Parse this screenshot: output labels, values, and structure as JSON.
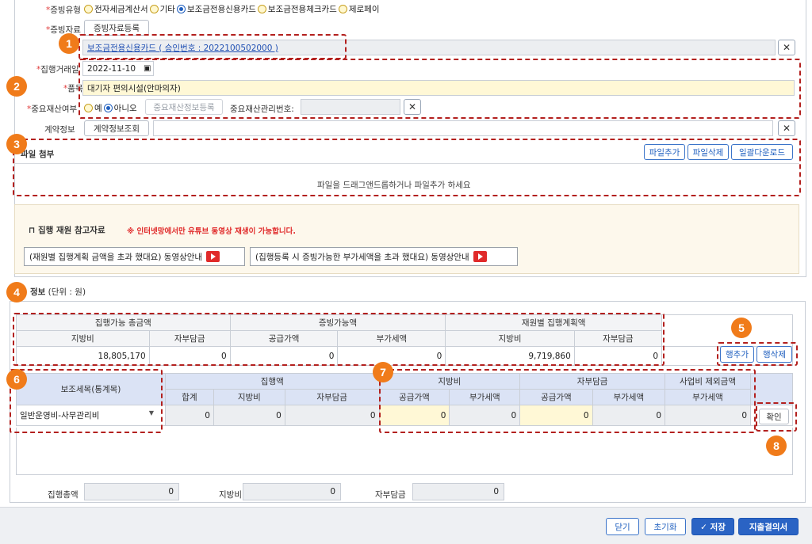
{
  "evidence_type": {
    "label": "증빙유형",
    "options": [
      "전자세금계산서",
      "기타",
      "보조금전용신용카드",
      "보조금전용체크카드",
      "제로페이"
    ],
    "selected": "보조금전용신용카드"
  },
  "evidence_data": {
    "label": "증빙자료",
    "button": "증빙자료등록",
    "link": "보조금전용신용카드 ( 승인번호 : 2022100502000 )"
  },
  "transaction_date": {
    "label": "집행거래일",
    "value": "2022-11-10"
  },
  "item": {
    "label": "품목",
    "value": "대기자 편의시설(안마의자)"
  },
  "important_asset": {
    "label": "중요재산여부",
    "options": [
      "예",
      "아니오"
    ],
    "selected": "아니오",
    "register_button": "중요재산정보등록",
    "mgmt_label": "중요재산관리번호:"
  },
  "contract": {
    "label": "계약정보",
    "button": "계약정보조회"
  },
  "attachment": {
    "title": "파일 첨부",
    "buttons": [
      "파일추가",
      "파일삭제",
      "일괄다운로드"
    ],
    "dropzone": "파일을 드래그앤드롭하거나  파일추가 하세요"
  },
  "reference": {
    "title": "집행 재원 참고자료",
    "notice": "※ 인터넷망에서만 유튜브 동영상 재생이 가능합니다.",
    "video1": "(재원별 집행계획 금액을 초과 했대요) 동영상안내",
    "video2": "(집행등록 시 증빙가능한 부가세액을 초과 했대요) 동영상안내"
  },
  "info": {
    "title": "정보",
    "unit": "(단위 : 원)"
  },
  "summary": {
    "groups": [
      "집행가능 총금액",
      "증빙가능액",
      "재원별 집행계획액"
    ],
    "subheaders": [
      "지방비",
      "자부담금",
      "공급가액",
      "부가세액",
      "지방비",
      "자부담금"
    ],
    "values": [
      "18,805,170",
      "0",
      "0",
      "0",
      "9,719,860",
      "0"
    ]
  },
  "row_buttons": {
    "add": "행추가",
    "delete": "행삭제"
  },
  "detail": {
    "col_item": "보조세목(통계목)",
    "group_exec": "집행액",
    "group_local": "지방비",
    "group_self": "자부담금",
    "group_exclude": "사업비 제외금액",
    "sub": [
      "합계",
      "지방비",
      "자부담금",
      "공급가액",
      "부가세액",
      "공급가액",
      "부가세액",
      "부가세액"
    ],
    "row_item": "일반운영비-사무관리비",
    "row_values": [
      "0",
      "0",
      "0",
      "0",
      "0",
      "0",
      "0",
      "0"
    ],
    "confirm": "확인"
  },
  "totals": {
    "exec_label": "집행총액",
    "exec_value": "0",
    "local_label": "지방비",
    "local_value": "0",
    "self_label": "자부담금",
    "self_value": "0"
  },
  "footer_buttons": {
    "close": "닫기",
    "reset": "초기화",
    "save": "✓ 저장",
    "resolution": "지출결의서"
  },
  "badges": [
    "1",
    "2",
    "3",
    "4",
    "5",
    "6",
    "7",
    "8"
  ],
  "colors": {
    "badge": "#f07b1a",
    "dash": "#b3201e",
    "primary": "#2a63c4",
    "highlight": "#fff8d6"
  }
}
